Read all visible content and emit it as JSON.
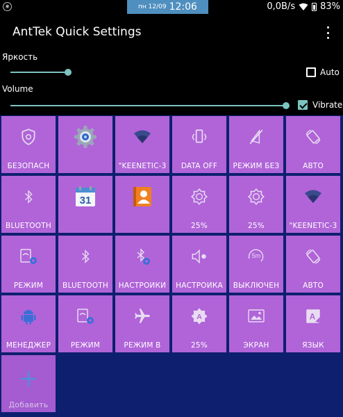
{
  "status_bar": {
    "date": "пн 12/09",
    "time": "12:06",
    "speed": "0,0B/s",
    "battery": "83%"
  },
  "app": {
    "title": "AntTek Quick Settings"
  },
  "brightness": {
    "label": "Яркость",
    "value_fraction": 0.2,
    "auto_label": "Auto",
    "auto_checked": false
  },
  "volume": {
    "label": "Volume",
    "value_fraction": 1.0,
    "vibrate_label": "Vibrate",
    "vibrate_checked": true
  },
  "tiles": [
    {
      "icon": "shield-icon",
      "label": "БЕЗОПАСН"
    },
    {
      "icon": "settings-gear-icon",
      "label": ""
    },
    {
      "icon": "wifi-icon",
      "label": "\"KEENETIC-3"
    },
    {
      "icon": "mobile-data-icon",
      "label": "DATA OFF"
    },
    {
      "icon": "mute-icon",
      "label": "РЕЖИМ БЕЗ"
    },
    {
      "icon": "auto-rotate-icon",
      "label": "АВТО"
    },
    {
      "icon": "bluetooth-icon",
      "label": "BLUETOOTH"
    },
    {
      "icon": "calendar-icon",
      "label": ""
    },
    {
      "icon": "contacts-icon",
      "label": ""
    },
    {
      "icon": "brightness-icon",
      "label": "25%"
    },
    {
      "icon": "brightness-icon",
      "label": "25%"
    },
    {
      "icon": "wifi-icon",
      "label": "\"KEENETIC-3"
    },
    {
      "icon": "wireless-settings-icon",
      "label": "РЕЖИМ"
    },
    {
      "icon": "bluetooth-icon",
      "label": "BLUETOOTH"
    },
    {
      "icon": "bluetooth-settings-icon",
      "label": "НАСТРОЙКИ"
    },
    {
      "icon": "volume-icon",
      "label": "НАСТРОЙКА"
    },
    {
      "icon": "timeout-icon",
      "label": "ВЫКЛЮЧЕН"
    },
    {
      "icon": "auto-rotate-icon",
      "label": "АВТО"
    },
    {
      "icon": "android-icon",
      "label": "МЕНЕДЖЕР"
    },
    {
      "icon": "wireless-settings-icon",
      "label": "РЕЖИМ"
    },
    {
      "icon": "airplane-icon",
      "label": "РЕЖИМ В"
    },
    {
      "icon": "auto-brightness-icon",
      "label": "25%"
    },
    {
      "icon": "wallpaper-icon",
      "label": "ЭКРАН"
    },
    {
      "icon": "language-icon",
      "label": "ЯЗЫК"
    },
    {
      "icon": "add-icon",
      "label": "Добавить"
    }
  ]
}
